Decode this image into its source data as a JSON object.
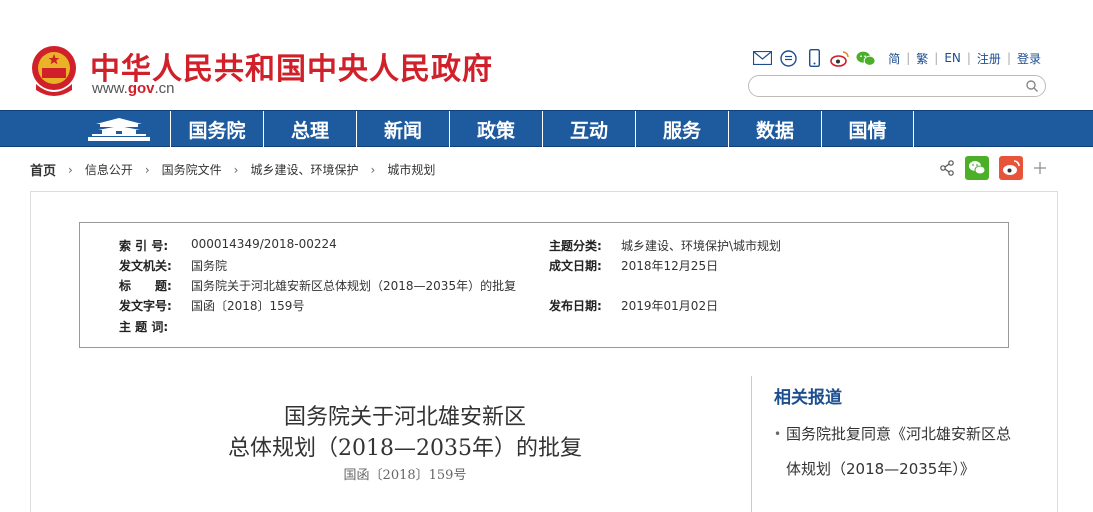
{
  "header": {
    "site_title": "中华人民共和国中央人民政府",
    "site_url_prefix": "www.",
    "site_url_gov": "gov",
    "site_url_suffix": ".cn",
    "tools": [
      "email-icon",
      "chat-icon",
      "mobile-icon",
      "weibo-icon",
      "wechat-icon"
    ],
    "lang_links": [
      "简",
      "繁",
      "EN",
      "注册",
      "登录"
    ],
    "search_placeholder": ""
  },
  "nav": {
    "items": [
      "国务院",
      "总理",
      "新闻",
      "政策",
      "互动",
      "服务",
      "数据",
      "国情"
    ]
  },
  "breadcrumb": {
    "items": [
      "首页",
      "信息公开",
      "国务院文件",
      "城乡建设、环境保护",
      "城市规划"
    ]
  },
  "meta": {
    "index_label": "索 引 号:",
    "index_value": "000014349/2018-00224",
    "issuer_label": "发文机关:",
    "issuer_value": "国务院",
    "subject_title_label": "标　　题:",
    "subject_title_value": "国务院关于河北雄安新区总体规划（2018—2035年）的批复",
    "doc_no_label": "发文字号:",
    "doc_no_value": "国函〔2018〕159号",
    "keywords_label": "主 题 词:",
    "keywords_value": "",
    "topic_label": "主题分类:",
    "topic_value": "城乡建设、环境保护\\城市规划",
    "written_label": "成文日期:",
    "written_value": "2018年12月25日",
    "publish_label": "发布日期:",
    "publish_value": "2019年01月02日"
  },
  "article": {
    "title_line1": "国务院关于河北雄安新区",
    "title_line2": "总体规划（2018—2035年）的批复",
    "doc_no": "国函〔2018〕159号"
  },
  "related": {
    "title": "相关报道",
    "item1": "国务院批复同意《河北雄安新区总体规划（2018—2035年）》"
  },
  "colors": {
    "brand_red": "#d0202a",
    "nav_blue": "#1d5a9e",
    "link_blue": "#1d4e8f"
  }
}
